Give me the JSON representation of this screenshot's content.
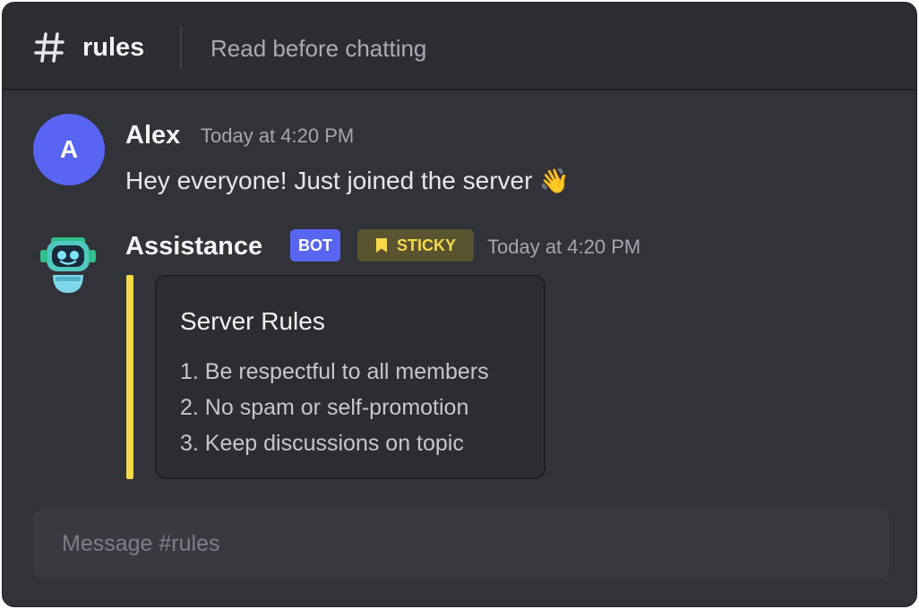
{
  "header": {
    "channel_name": "rules",
    "topic": "Read before chatting"
  },
  "messages": [
    {
      "avatar_initial": "A",
      "author": "Alex",
      "timestamp": "Today at 4:20 PM",
      "text": "Hey everyone! Just joined the server",
      "emoji": "👋"
    },
    {
      "author": "Assistance",
      "bot_tag": "BOT",
      "sticky_tag": "STICKY",
      "timestamp": "Today at 4:20 PM",
      "embed": {
        "title": "Server Rules",
        "rules": [
          "1. Be respectful to all members",
          "2. No spam or self-promotion",
          "3. Keep discussions on topic"
        ]
      }
    }
  ],
  "composer": {
    "placeholder": "Message #rules"
  },
  "colors": {
    "background": "#313338",
    "header": "#2b2d31",
    "accent": "#5865f2",
    "sticky": "#f5d94a"
  },
  "icons": [
    "hash-icon",
    "bookmark-icon",
    "robot-avatar-icon"
  ]
}
